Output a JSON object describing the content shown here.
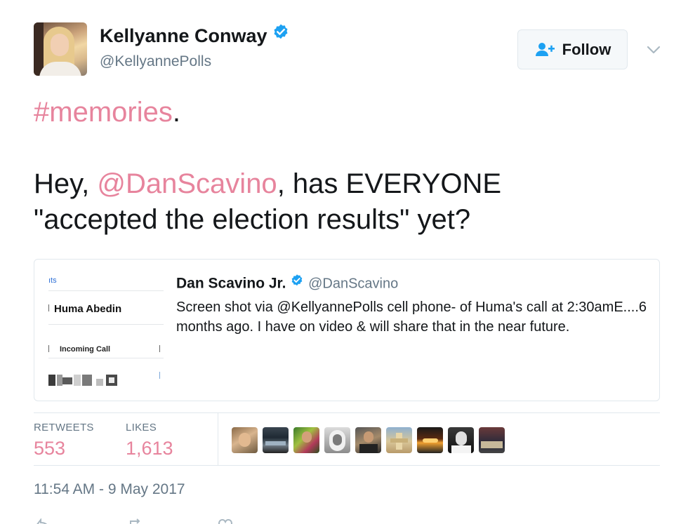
{
  "author": {
    "name": "Kellyanne Conway",
    "handle": "@KellyannePolls",
    "verified": true
  },
  "follow_button": {
    "label": "Follow"
  },
  "tweet": {
    "line1_tag": "#memories",
    "line1_tail": ".",
    "line2_pre": "Hey, ",
    "line2_mention": "@DanScavino",
    "line2_post": ", has EVERYONE",
    "line3": "\"accepted the election results\" yet?"
  },
  "quoted": {
    "name": "Dan Scavino Jr.",
    "handle": "@DanScavino",
    "text": "Screen shot via @KellyannePolls cell phone- of Huma's call at 2:30amE....6 months ago. I have on video & will share that in the near future.",
    "thumbnail": {
      "header_text": "ıts",
      "contact_name": "Huma Abedin",
      "call_label": "Incoming Call"
    }
  },
  "stats": {
    "retweets_label": "RETWEETS",
    "retweets_count": "553",
    "likes_label": "LIKES",
    "likes_count": "1,613"
  },
  "likers_count_shown": 9,
  "timestamp": "11:54 AM - 9 May 2017",
  "colors": {
    "accent_pink": "#e7849d",
    "verified_blue": "#1da1f2",
    "secondary_gray": "#657786",
    "border": "#e1e8ed"
  },
  "icons": {
    "verified": "verified-badge-icon",
    "follow": "add-user-icon",
    "menu": "chevron-down-icon",
    "reply": "reply-icon",
    "retweet": "retweet-icon",
    "like": "heart-icon"
  }
}
